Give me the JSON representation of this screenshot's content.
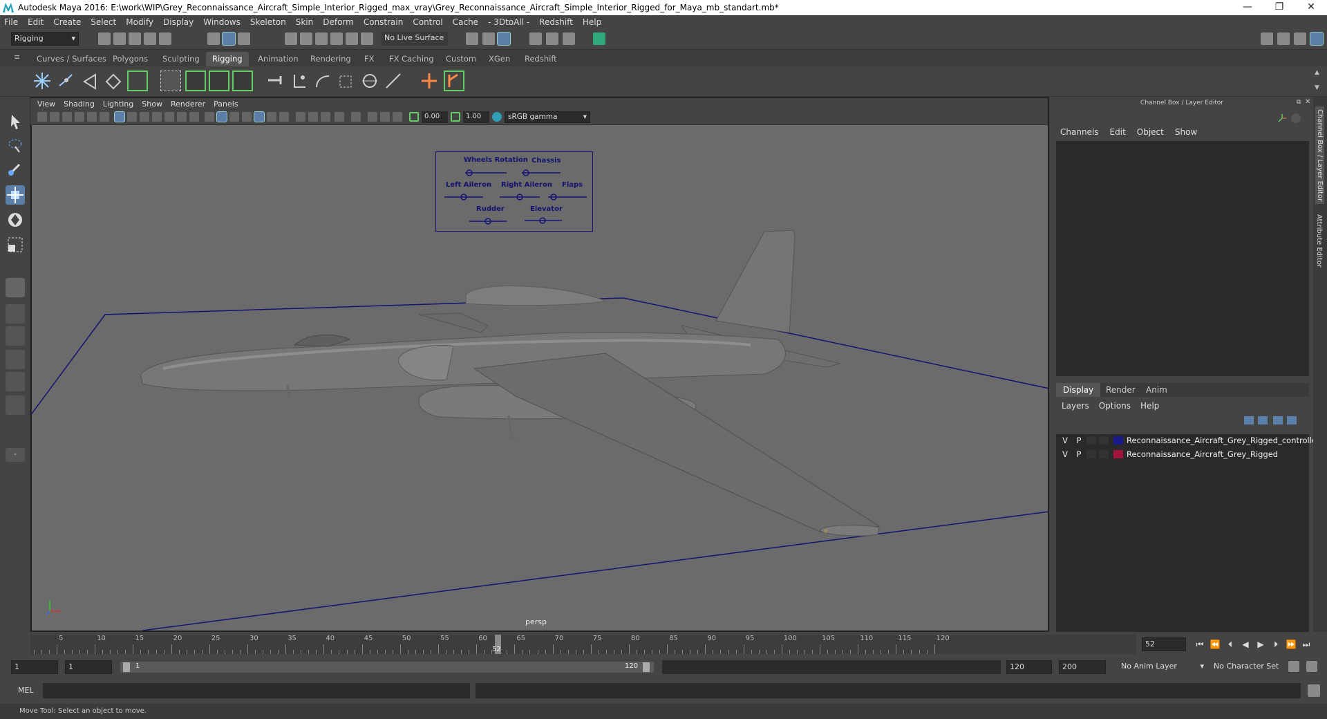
{
  "titlebar": {
    "title": "Autodesk Maya 2016: E:\\work\\WIP\\Grey_Reconnaissance_Aircraft_Simple_Interior_Rigged_max_vray\\Grey_Reconnaissance_Aircraft_Simple_Interior_Rigged_for_Maya_mb_standart.mb*",
    "minimize": "—",
    "maximize": "❐",
    "close": "✕"
  },
  "menubar": [
    "File",
    "Edit",
    "Create",
    "Select",
    "Modify",
    "Display",
    "Windows",
    "Skeleton",
    "Skin",
    "Deform",
    "Constrain",
    "Control",
    "Cache",
    "- 3DtoAll -",
    "Redshift",
    "Help"
  ],
  "statusline": {
    "mode": "Rigging",
    "live_surface": "No Live Surface"
  },
  "shelf_tabs": [
    "Curves / Surfaces",
    "Polygons",
    "Sculpting",
    "Rigging",
    "Animation",
    "Rendering",
    "FX",
    "FX Caching",
    "Custom",
    "XGen",
    "Redshift"
  ],
  "active_shelf": "Rigging",
  "viewport": {
    "menu": [
      "View",
      "Shading",
      "Lighting",
      "Show",
      "Renderer",
      "Panels"
    ],
    "near_value": "0.00",
    "far_value": "1.00",
    "color_space": "sRGB gamma",
    "camera_label": "persp",
    "controller": {
      "labels": {
        "wheels": "Wheels Rotation",
        "chassis": "Chassis",
        "left_aileron": "Left Aileron",
        "right_aileron": "Right Aileron",
        "flaps": "Flaps",
        "rudder": "Rudder",
        "elevator": "Elevator"
      }
    }
  },
  "channel_box": {
    "title": "Channel Box / Layer Editor",
    "menu": [
      "Channels",
      "Edit",
      "Object",
      "Show"
    ],
    "layer_tabs": [
      "Display",
      "Render",
      "Anim"
    ],
    "active_layer_tab": "Display",
    "layer_menu": [
      "Layers",
      "Options",
      "Help"
    ],
    "layers": [
      {
        "v": "V",
        "p": "P",
        "color": "#1a1a8a",
        "name": "Reconnaissance_Aircraft_Grey_Rigged_controllers"
      },
      {
        "v": "V",
        "p": "P",
        "color": "#a3143c",
        "name": "Reconnaissance_Aircraft_Grey_Rigged"
      }
    ]
  },
  "side_tabs": {
    "channel": "Channel Box / Layer Editor",
    "attr": "Attribute Editor"
  },
  "timeline": {
    "tick_labels": [
      "5",
      "10",
      "15",
      "20",
      "25",
      "30",
      "35",
      "40",
      "45",
      "50",
      "55",
      "60",
      "65",
      "70",
      "75",
      "80",
      "85",
      "90",
      "95",
      "100",
      "105",
      "110",
      "115",
      "120"
    ],
    "current_frame": "52",
    "current_frame_field": "52"
  },
  "range": {
    "start": "1",
    "start2": "1",
    "slider_start": "1",
    "slider_end": "120",
    "end": "120",
    "end2": "200",
    "anim_layer": "No Anim Layer",
    "char_set": "No Character Set"
  },
  "cmdline": {
    "label": "MEL"
  },
  "helpline": {
    "text": "Move Tool: Select an object to move."
  }
}
